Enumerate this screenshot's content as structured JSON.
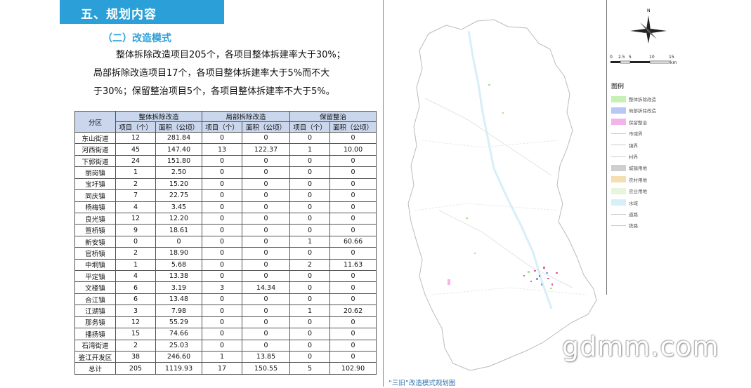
{
  "header": {
    "title": "五、规划内容"
  },
  "subtitle": "（二）改造模式",
  "paragraph": {
    "line1": "整体拆除改造项目205个，各项目整体拆建率大于30%；",
    "line2": "局部拆除改造项目17个，各项目整体拆建率大于5%而不大",
    "line3": "于30%；保留整治项目5个，各项目整体拆建率不大于5%。"
  },
  "table": {
    "col_district": "分区",
    "group1": "整体拆除改造",
    "group2": "局部拆除改造",
    "group3": "保留整治",
    "sub_count": "项目（个）",
    "sub_area": "面积（公顷）",
    "rows": [
      [
        "东山街道",
        "12",
        "281.84",
        "0",
        "0",
        "0",
        "0"
      ],
      [
        "河西街道",
        "45",
        "147.40",
        "13",
        "122.37",
        "1",
        "10.00"
      ],
      [
        "下郭街道",
        "24",
        "151.80",
        "0",
        "0",
        "0",
        "0"
      ],
      [
        "丽岗镇",
        "1",
        "2.50",
        "0",
        "0",
        "0",
        "0"
      ],
      [
        "宝圩镇",
        "2",
        "15.20",
        "0",
        "0",
        "0",
        "0"
      ],
      [
        "同庆镇",
        "7",
        "22.75",
        "0",
        "0",
        "0",
        "0"
      ],
      [
        "杨梅镇",
        "4",
        "3.45",
        "0",
        "0",
        "0",
        "0"
      ],
      [
        "良光镇",
        "12",
        "12.20",
        "0",
        "0",
        "0",
        "0"
      ],
      [
        "笪桥镇",
        "9",
        "18.61",
        "0",
        "0",
        "0",
        "0"
      ],
      [
        "新安镇",
        "0",
        "0",
        "0",
        "0",
        "1",
        "60.66"
      ],
      [
        "官桥镇",
        "2",
        "18.90",
        "0",
        "0",
        "0",
        "0"
      ],
      [
        "中垌镇",
        "1",
        "5.68",
        "0",
        "0",
        "2",
        "11.63"
      ],
      [
        "平定镇",
        "4",
        "13.38",
        "0",
        "0",
        "0",
        "0"
      ],
      [
        "文楼镇",
        "6",
        "3.19",
        "3",
        "14.34",
        "0",
        "0"
      ],
      [
        "合江镇",
        "6",
        "13.48",
        "0",
        "0",
        "0",
        "0"
      ],
      [
        "江湖镇",
        "3",
        "7.98",
        "0",
        "0",
        "1",
        "20.62"
      ],
      [
        "那务镇",
        "12",
        "55.29",
        "0",
        "0",
        "0",
        "0"
      ],
      [
        "播扬镇",
        "15",
        "74.66",
        "0",
        "0",
        "0",
        "0"
      ],
      [
        "石湾街道",
        "2",
        "25.03",
        "0",
        "0",
        "0",
        "0"
      ],
      [
        "鉴江开发区",
        "38",
        "246.60",
        "1",
        "13.85",
        "0",
        "0"
      ],
      [
        "总计",
        "205",
        "1119.93",
        "17",
        "150.55",
        "5",
        "102.90"
      ]
    ]
  },
  "map": {
    "caption": "“三旧”改造模式规划图",
    "north": "N",
    "scale_labels": [
      "0",
      "2.5",
      "5",
      "10",
      "15"
    ],
    "scale_unit": "km",
    "legend_title": "图例",
    "legend": [
      {
        "label": "整体拆除改造",
        "color": "#c6f0b5",
        "kind": "fill"
      },
      {
        "label": "局部拆除改造",
        "color": "#b7c8f5",
        "kind": "fill"
      },
      {
        "label": "保留整治",
        "color": "#f2b5e8",
        "kind": "fill"
      },
      {
        "label": "市域界",
        "color": "#cccccc",
        "kind": "line"
      },
      {
        "label": "镇界",
        "color": "#cccccc",
        "kind": "line"
      },
      {
        "label": "村界",
        "color": "#cccccc",
        "kind": "line"
      },
      {
        "label": "城镇用地",
        "color": "#cfcfcf",
        "kind": "fill"
      },
      {
        "label": "农村用地",
        "color": "#f5dfb0",
        "kind": "fill"
      },
      {
        "label": "农业用地",
        "color": "#e8f5dc",
        "kind": "fill"
      },
      {
        "label": "水域",
        "color": "#d7eff8",
        "kind": "fill"
      },
      {
        "label": "道路",
        "color": "#cccccc",
        "kind": "line"
      },
      {
        "label": "铁路",
        "color": "#cccccc",
        "kind": "line"
      }
    ]
  },
  "watermark": "gdmm.com"
}
